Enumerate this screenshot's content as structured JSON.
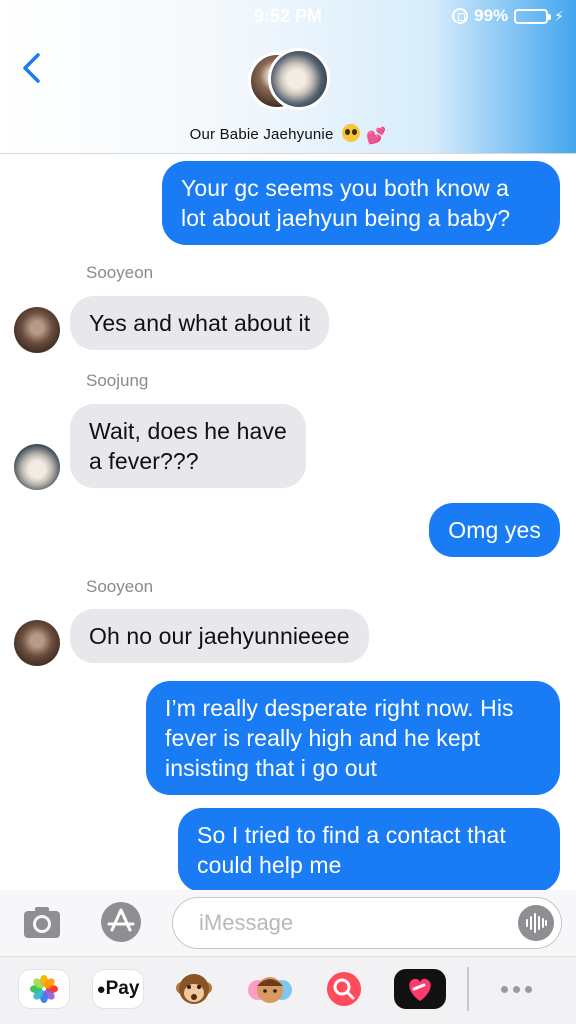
{
  "status_bar": {
    "time": "9:52 PM",
    "battery": "99%"
  },
  "header": {
    "group_name": "Our Babie Jaehyunie",
    "group_emoji_icons": [
      "pleading-face-icon",
      "two-hearts-icon"
    ]
  },
  "messages": [
    {
      "direction": "outgoing",
      "text_lines": [
        "Your gc seems you both know a",
        "lot about jaehyun being a baby?"
      ]
    },
    {
      "direction": "incoming",
      "sender": "Sooyeon",
      "text_lines": [
        "Yes and what about it"
      ]
    },
    {
      "direction": "incoming",
      "sender": "Soojung",
      "text_lines": [
        "Wait, does he have",
        "a fever???"
      ]
    },
    {
      "direction": "outgoing",
      "text_lines": [
        "Omg yes"
      ]
    },
    {
      "direction": "incoming",
      "sender": "Sooyeon",
      "text_lines": [
        "Oh no our jaehyunnieeee"
      ]
    },
    {
      "direction": "outgoing",
      "text_lines": [
        "I’m really desperate right now. His",
        "fever is really high and he kept",
        "insisting that i go out"
      ]
    },
    {
      "direction": "outgoing",
      "text_lines": [
        "So I tried to find a contact that",
        "could help me"
      ]
    }
  ],
  "composer": {
    "placeholder": "iMessage"
  },
  "app_drawer": {
    "apps": [
      "photos-icon",
      "apple-pay-icon",
      "monkey-animoji-icon",
      "memoji-icon",
      "search-images-icon",
      "heart-sticker-icon"
    ],
    "apple_pay_label": "Pay"
  },
  "colors": {
    "outgoing_bubble": "#1a7cf5",
    "incoming_bubble": "#e7e7ec",
    "accent": "#1a7cf5"
  }
}
